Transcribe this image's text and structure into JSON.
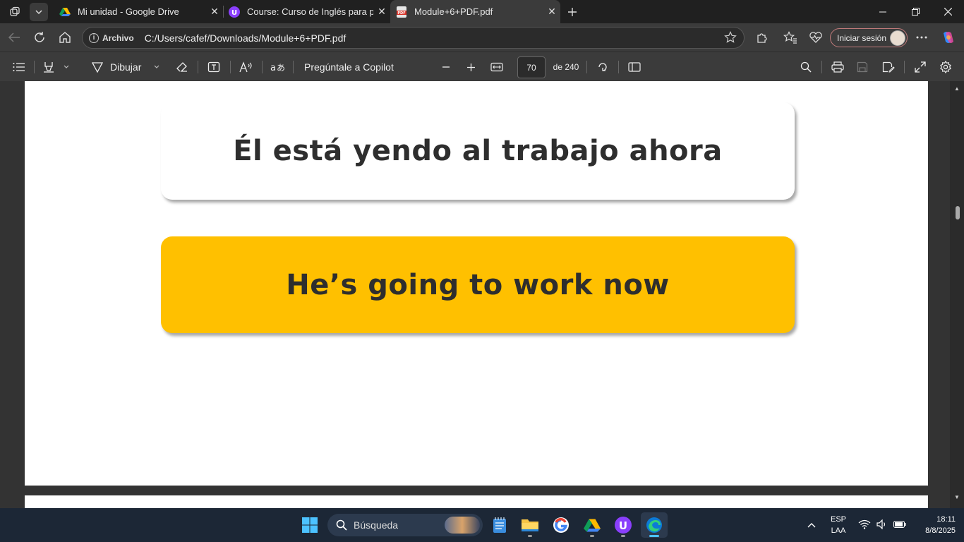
{
  "tabs": [
    {
      "title": "Mi unidad - Google Drive",
      "active": false
    },
    {
      "title": "Course: Curso de Inglés para principiantes",
      "active": false
    },
    {
      "title": "Module+6+PDF.pdf",
      "active": true
    }
  ],
  "tab_close_glyph": "✕",
  "address": {
    "protocol_label": "Archivo",
    "url": "C:/Users/cafef/Downloads/Module+6+PDF.pdf"
  },
  "signin_label": "Iniciar sesión",
  "pdf_toolbar": {
    "draw_label": "Dibujar",
    "copilot_label": "Pregúntale a Copilot",
    "page_current": "70",
    "page_total_label": "de 240"
  },
  "pdf_page": {
    "spanish_sentence": "Él está yendo al trabajo ahora",
    "english_sentence": "He’s going to work now",
    "card_accent_color": "#ffc000"
  },
  "taskbar": {
    "search_placeholder": "Búsqueda",
    "lang_top": "ESP",
    "lang_bottom": "LAA",
    "time": "18:11",
    "date": "8/8/2025"
  }
}
